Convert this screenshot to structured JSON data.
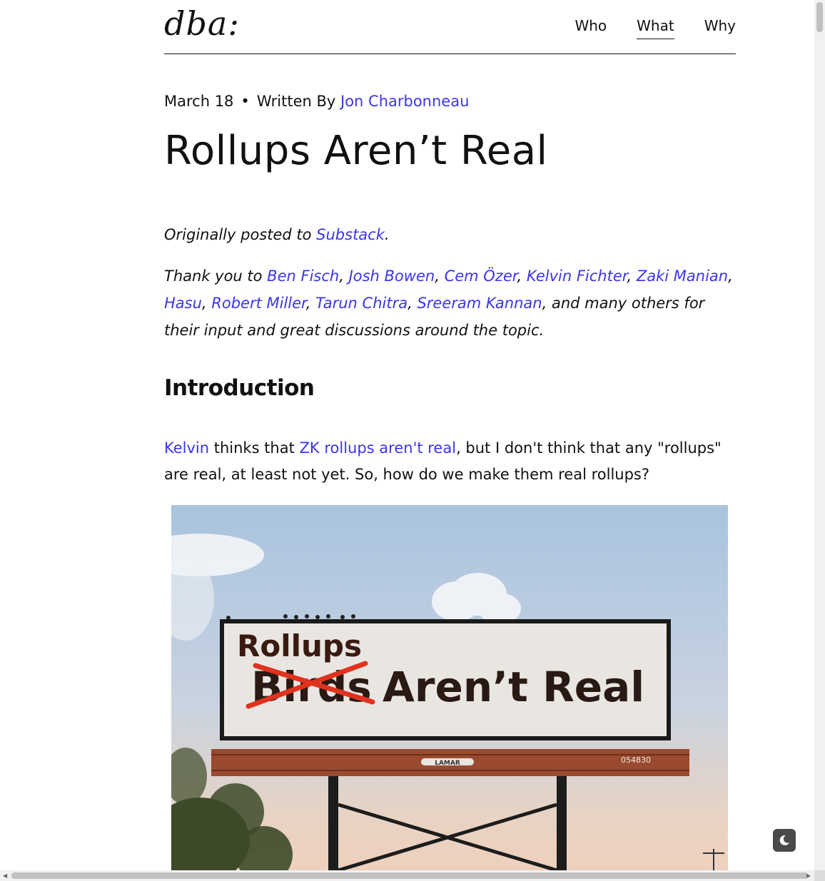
{
  "header": {
    "logo": "dba:",
    "nav": [
      {
        "label": "Who",
        "active": false
      },
      {
        "label": "What",
        "active": true
      },
      {
        "label": "Why",
        "active": false
      }
    ]
  },
  "article": {
    "date": "March 18",
    "separator": "•",
    "written_by": "Written By",
    "author": "Jon Charbonneau",
    "title": "Rollups Aren’t Real",
    "originally_posted": "Originally posted to ",
    "substack_link": "Substack",
    "period": ".",
    "thanks_prefix": "Thank you to ",
    "thanks_names": [
      "Ben Fisch",
      "Josh Bowen",
      "Cem Özer",
      "Kelvin Fichter",
      "Zaki Manian",
      "Hasu",
      "Robert Miller",
      "Tarun Chitra",
      "Sreeram Kannan"
    ],
    "thanks_suffix": ", and many others for their input and great discussions around the topic.",
    "comma": ", ",
    "intro_heading": "Introduction",
    "p1_link1": "Kelvin",
    "p1_text1": " thinks that ",
    "p1_link2": "ZK rollups aren't real",
    "p1_text2": ", but I don't think that any \"rollups\" are real, at least not yet. So, how do we make them real rollups?"
  },
  "billboard": {
    "top_word": "Rollups",
    "crossed_word": "Birds",
    "main_text": "Aren’t Real",
    "brand": "LAMAR",
    "panel_number": "054830"
  },
  "theme_toggle": {
    "icon": "moon-icon"
  }
}
